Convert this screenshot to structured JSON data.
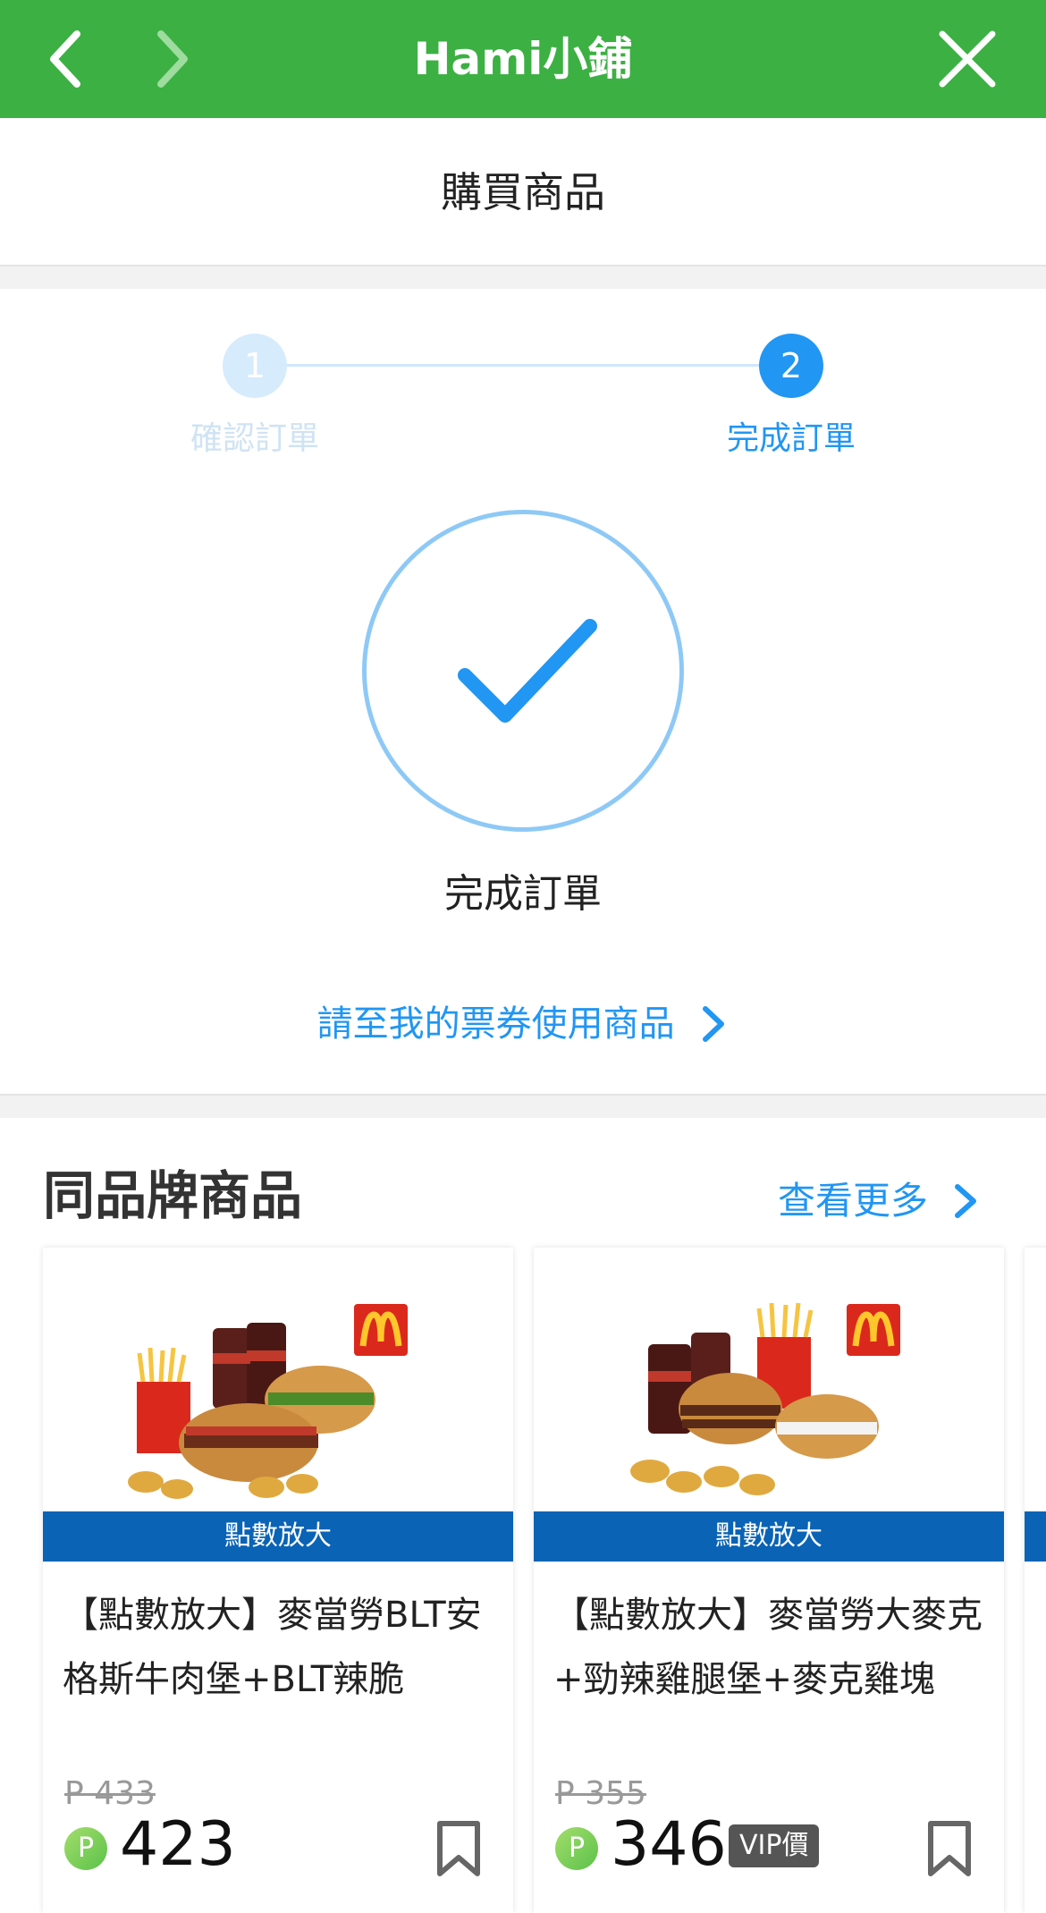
{
  "topbar": {
    "title": "Hami小鋪",
    "back_icon": "chevron-left-icon",
    "forward_icon": "chevron-right-icon",
    "close_icon": "close-icon",
    "bg_color": "#3cb043"
  },
  "subheader": {
    "title": "購買商品"
  },
  "steps": [
    {
      "number": "1",
      "label": "確認訂單",
      "state": "done"
    },
    {
      "number": "2",
      "label": "完成訂單",
      "state": "active"
    }
  ],
  "success": {
    "icon": "checkmark-icon",
    "label": "完成訂單",
    "link_label": "請至我的票券使用商品"
  },
  "brand_section": {
    "title": "同品牌商品",
    "see_more": "查看更多",
    "products": [
      {
        "banner": "點數放大",
        "name": "【點數放大】麥當勞BLT安格斯牛肉堡+BLT辣脆",
        "original_price": "P 433",
        "price": "423",
        "point_badge": "P",
        "vip_label": ""
      },
      {
        "banner": "點數放大",
        "name": "【點數放大】麥當勞大麥克+勁辣雞腿堡+麥克雞塊",
        "original_price": "P 355",
        "price": "346",
        "point_badge": "P",
        "vip_label": "VIP價"
      }
    ]
  },
  "colors": {
    "accent": "#2196f3",
    "banner": "#0a63b5",
    "brand_green": "#3cb043"
  }
}
